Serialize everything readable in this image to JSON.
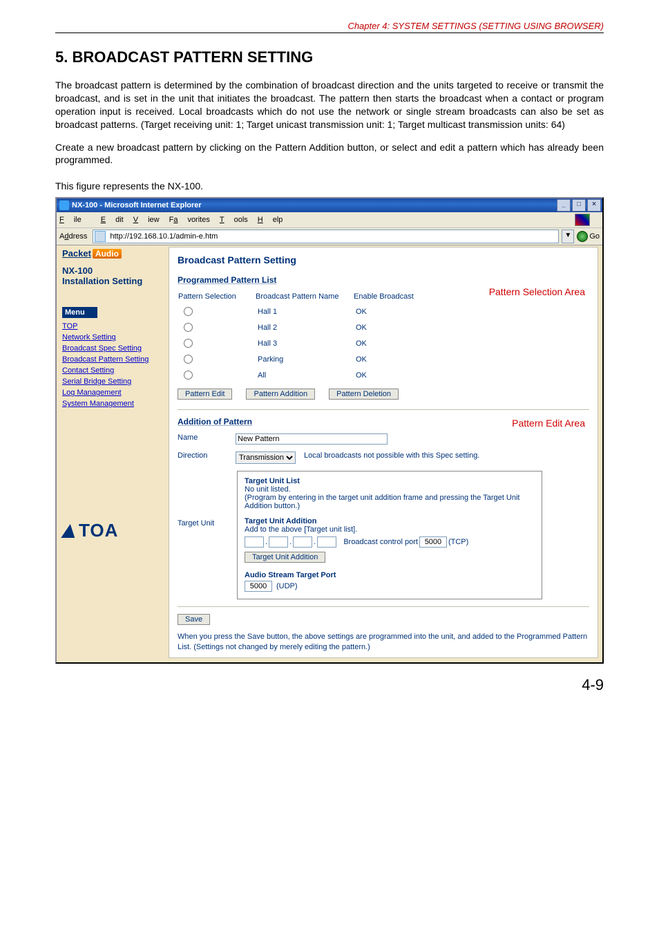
{
  "chapter_header": "Chapter 4:  SYSTEM SETTINGS (SETTING USING BROWSER)",
  "section_title": "5. BROADCAST PATTERN SETTING",
  "paragraph1": "The broadcast pattern is determined by the combination of broadcast direction and the units targeted to receive or transmit the broadcast, and is set in the unit that initiates the broadcast. The pattern then starts the broadcast when a contact or program operation input is received. Local broadcasts which do not use the network or single stream broadcasts can also be set as broadcast patterns. (Target receiving unit: 1; Target unicast transmission unit: 1; Target multicast transmission units: 64)",
  "paragraph2": "Create a new broadcast pattern by clicking on the Pattern Addition button, or select and edit a pattern which has already been programmed.",
  "figure_caption": "This figure represents the NX-100.",
  "page_number": "4-9",
  "browser": {
    "window_title": "NX-100 - Microsoft Internet Explorer",
    "menus": {
      "file": "File",
      "edit": "Edit",
      "view": "View",
      "favorites": "Favorites",
      "tools": "Tools",
      "help": "Help"
    },
    "address_label": "Address",
    "url": "http://192.168.10.1/admin-e.htm",
    "go_label": "Go",
    "win_buttons": {
      "min": "_",
      "max": "□",
      "close": "×"
    }
  },
  "sidebar": {
    "brand_packet": "Packet",
    "brand_audio": "Audio",
    "model": "NX-100",
    "subtitle": "Installation Setting",
    "menu_label": "Menu",
    "items": [
      {
        "label": "TOP"
      },
      {
        "label": "Network Setting"
      },
      {
        "label": "Broadcast Spec Setting"
      },
      {
        "label": "Broadcast Pattern Setting"
      },
      {
        "label": "Contact Setting"
      },
      {
        "label": "Serial Bridge Setting"
      },
      {
        "label": "Log Management"
      },
      {
        "label": "System Management"
      }
    ],
    "logo_text": "TOA"
  },
  "main": {
    "title": "Broadcast Pattern Setting",
    "list_heading": "Programmed Pattern List",
    "columns": {
      "sel": "Pattern Selection",
      "name": "Broadcast Pattern Name",
      "enable": "Enable Broadcast"
    },
    "rows": [
      {
        "name": "Hall 1",
        "enable": "OK"
      },
      {
        "name": "Hall 2",
        "enable": "OK"
      },
      {
        "name": "Hall 3",
        "enable": "OK"
      },
      {
        "name": "Parking",
        "enable": "OK"
      },
      {
        "name": "All",
        "enable": "OK"
      }
    ],
    "buttons": {
      "edit": "Pattern Edit",
      "add": "Pattern Addition",
      "del": "Pattern Deletion"
    },
    "edit_heading": "Addition of Pattern",
    "name_label": "Name",
    "name_value": "New Pattern",
    "direction_label": "Direction",
    "direction_value": "Transmission",
    "direction_note": "Local broadcasts not possible with this Spec setting.",
    "target_label": "Target Unit",
    "tu_list_heading": "Target Unit List",
    "tu_list_empty": "No unit listed.",
    "tu_list_note": "(Program by entering in the target unit addition frame and pressing the Target Unit Addition button.)",
    "tu_add_heading": "Target Unit Addition",
    "tu_add_note": "Add to the above [Target unit list].",
    "ip_octets": [
      "",
      "",
      "",
      ""
    ],
    "ctrl_port_label": "Broadcast control port",
    "ctrl_port_value": "5000",
    "ctrl_port_proto": "(TCP)",
    "tu_add_button": "Target Unit Addition",
    "audio_port_heading": "Audio Stream Target Port",
    "audio_port_value": "5000",
    "audio_port_proto": "(UDP)",
    "save_label": "Save",
    "save_note": "When you press the Save button, the above settings are programmed into the unit, and added to the Programmed Pattern List.\n(Settings not changed by merely editing the pattern.)"
  },
  "annotations": {
    "selection_area": "Pattern Selection Area",
    "edit_area": "Pattern Edit Area"
  }
}
